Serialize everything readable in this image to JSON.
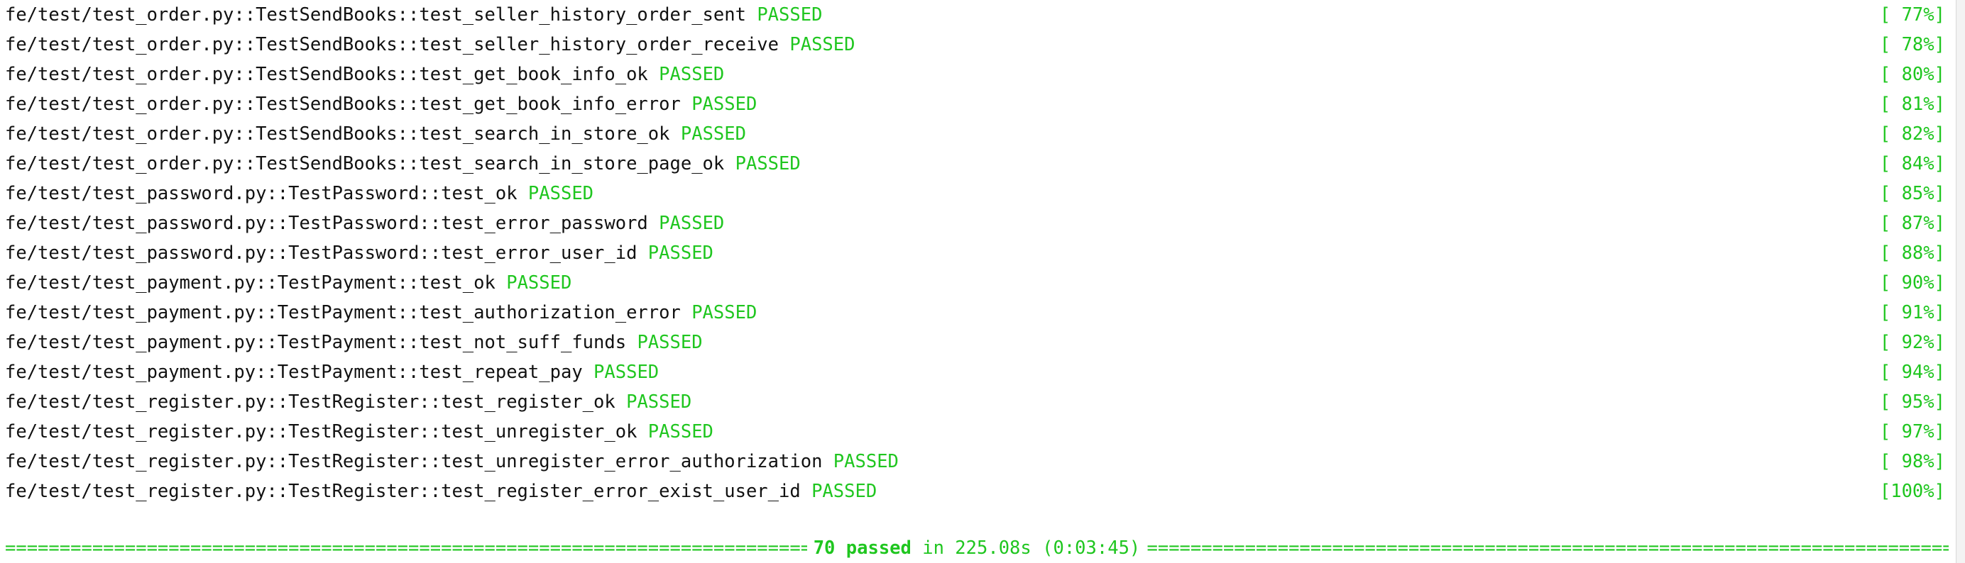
{
  "colors": {
    "pass": "#1fc61f",
    "text": "#111111",
    "background": "#ffffff"
  },
  "lines": [
    {
      "test_id": "fe/test/test_order.py::TestSendBooks::test_seller_history_order_sent",
      "status": "PASSED",
      "progress": "[ 77%]"
    },
    {
      "test_id": "fe/test/test_order.py::TestSendBooks::test_seller_history_order_receive",
      "status": "PASSED",
      "progress": "[ 78%]"
    },
    {
      "test_id": "fe/test/test_order.py::TestSendBooks::test_get_book_info_ok",
      "status": "PASSED",
      "progress": "[ 80%]"
    },
    {
      "test_id": "fe/test/test_order.py::TestSendBooks::test_get_book_info_error",
      "status": "PASSED",
      "progress": "[ 81%]"
    },
    {
      "test_id": "fe/test/test_order.py::TestSendBooks::test_search_in_store_ok",
      "status": "PASSED",
      "progress": "[ 82%]"
    },
    {
      "test_id": "fe/test/test_order.py::TestSendBooks::test_search_in_store_page_ok",
      "status": "PASSED",
      "progress": "[ 84%]"
    },
    {
      "test_id": "fe/test/test_password.py::TestPassword::test_ok",
      "status": "PASSED",
      "progress": "[ 85%]"
    },
    {
      "test_id": "fe/test/test_password.py::TestPassword::test_error_password",
      "status": "PASSED",
      "progress": "[ 87%]"
    },
    {
      "test_id": "fe/test/test_password.py::TestPassword::test_error_user_id",
      "status": "PASSED",
      "progress": "[ 88%]"
    },
    {
      "test_id": "fe/test/test_payment.py::TestPayment::test_ok",
      "status": "PASSED",
      "progress": "[ 90%]"
    },
    {
      "test_id": "fe/test/test_payment.py::TestPayment::test_authorization_error",
      "status": "PASSED",
      "progress": "[ 91%]"
    },
    {
      "test_id": "fe/test/test_payment.py::TestPayment::test_not_suff_funds",
      "status": "PASSED",
      "progress": "[ 92%]"
    },
    {
      "test_id": "fe/test/test_payment.py::TestPayment::test_repeat_pay",
      "status": "PASSED",
      "progress": "[ 94%]"
    },
    {
      "test_id": "fe/test/test_register.py::TestRegister::test_register_ok",
      "status": "PASSED",
      "progress": "[ 95%]"
    },
    {
      "test_id": "fe/test/test_register.py::TestRegister::test_unregister_ok",
      "status": "PASSED",
      "progress": "[ 97%]"
    },
    {
      "test_id": "fe/test/test_register.py::TestRegister::test_unregister_error_authorization",
      "status": "PASSED",
      "progress": "[ 98%]"
    },
    {
      "test_id": "fe/test/test_register.py::TestRegister::test_register_error_exist_user_id",
      "status": "PASSED",
      "progress": "[100%]"
    }
  ],
  "summary": {
    "count": "70 passed",
    "duration": "in 225.08s (0:03:45)",
    "rule_char": "="
  }
}
